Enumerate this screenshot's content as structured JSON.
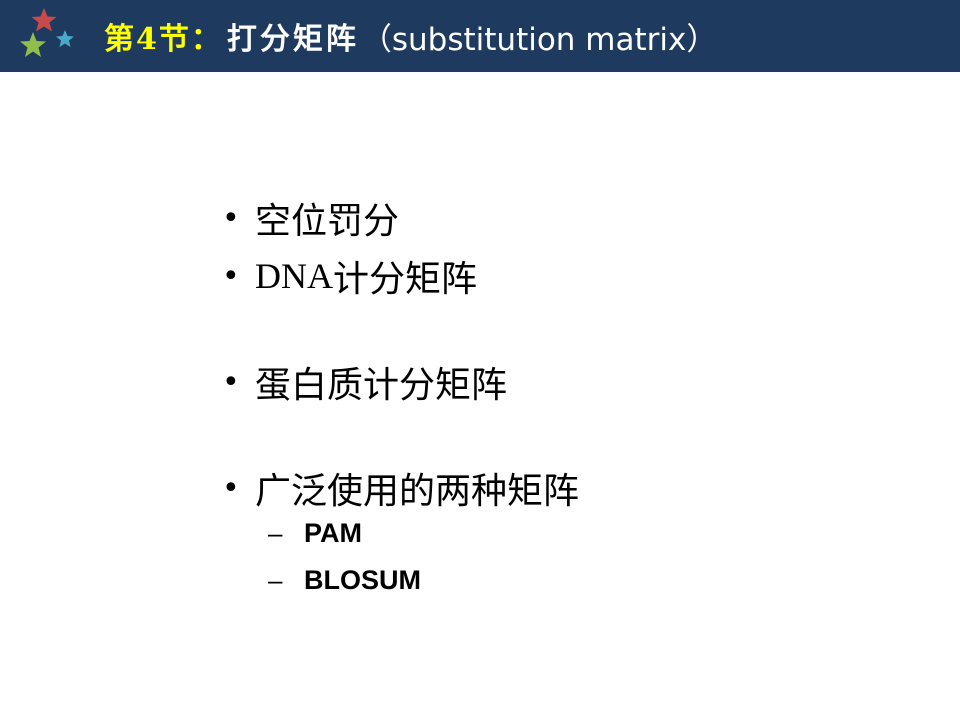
{
  "header": {
    "title_prefix": "第4节：",
    "title_main": "打分矩阵",
    "title_en": "（substitution matrix）"
  },
  "bullets": [
    {
      "marker": "•",
      "text": "空位罚分"
    },
    {
      "marker": "•",
      "text_latin": "DNA",
      "text": "计分矩阵"
    },
    {
      "marker": "•",
      "text": "蛋白质计分矩阵"
    },
    {
      "marker": "•",
      "text": "广泛使用的两种矩阵"
    }
  ],
  "sub_bullets": [
    {
      "marker": "–",
      "text": "PAM"
    },
    {
      "marker": "–",
      "text": "BLOSUM"
    }
  ],
  "colors": {
    "header_bg": "#1e3a5f",
    "title_prefix": "#ffff00",
    "title_text": "#ffffff",
    "star_red": "#c94a4a",
    "star_green": "#8fbf4a",
    "star_blue": "#4aa8c9"
  }
}
